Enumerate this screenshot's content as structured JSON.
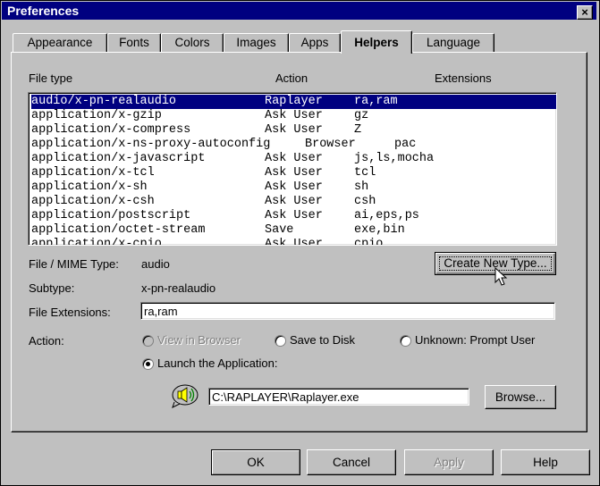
{
  "window": {
    "title": "Preferences",
    "close_glyph": "×"
  },
  "tabs": [
    {
      "label": "Appearance"
    },
    {
      "label": "Fonts"
    },
    {
      "label": "Colors"
    },
    {
      "label": "Images"
    },
    {
      "label": "Apps"
    },
    {
      "label": "Helpers"
    },
    {
      "label": "Language"
    }
  ],
  "active_tab": "Helpers",
  "list": {
    "headers": {
      "file_type": "File type",
      "action": "Action",
      "extensions": "Extensions"
    },
    "rows": [
      {
        "type": "audio/x-pn-realaudio",
        "action": "Raplayer",
        "ext": "ra,ram"
      },
      {
        "type": "application/x-gzip",
        "action": "Ask User",
        "ext": "gz"
      },
      {
        "type": "application/x-compress",
        "action": "Ask User",
        "ext": "Z"
      },
      {
        "type": "application/x-ns-proxy-autoconfig",
        "action": "Browser",
        "ext": "pac"
      },
      {
        "type": "application/x-javascript",
        "action": "Ask User",
        "ext": "js,ls,mocha"
      },
      {
        "type": "application/x-tcl",
        "action": "Ask User",
        "ext": "tcl"
      },
      {
        "type": "application/x-sh",
        "action": "Ask User",
        "ext": "sh"
      },
      {
        "type": "application/x-csh",
        "action": "Ask User",
        "ext": "csh"
      },
      {
        "type": "application/postscript",
        "action": "Ask User",
        "ext": "ai,eps,ps"
      },
      {
        "type": "application/octet-stream",
        "action": "Save",
        "ext": "exe,bin"
      },
      {
        "type": "application/x-cpio",
        "action": "Ask User",
        "ext": "cpio"
      }
    ],
    "selected_index": 0
  },
  "details": {
    "mime_label": "File / MIME Type:",
    "mime_value": "audio",
    "subtype_label": "Subtype:",
    "subtype_value": "x-pn-realaudio",
    "ext_label": "File Extensions:",
    "ext_value": "ra,ram",
    "create_button": "Create New Type..."
  },
  "action": {
    "label": "Action:",
    "view_in_browser": "View in Browser",
    "save_to_disk": "Save to Disk",
    "unknown_prompt": "Unknown: Prompt User",
    "launch_app": "Launch the Application:",
    "app_path": "C:\\RAPLAYER\\Raplayer.exe",
    "browse_button": "Browse..."
  },
  "footer": {
    "ok": "OK",
    "cancel": "Cancel",
    "apply": "Apply",
    "help": "Help"
  },
  "colors": {
    "titlebar": "#000080",
    "face": "#c0c0c0",
    "selection": "#000080"
  }
}
